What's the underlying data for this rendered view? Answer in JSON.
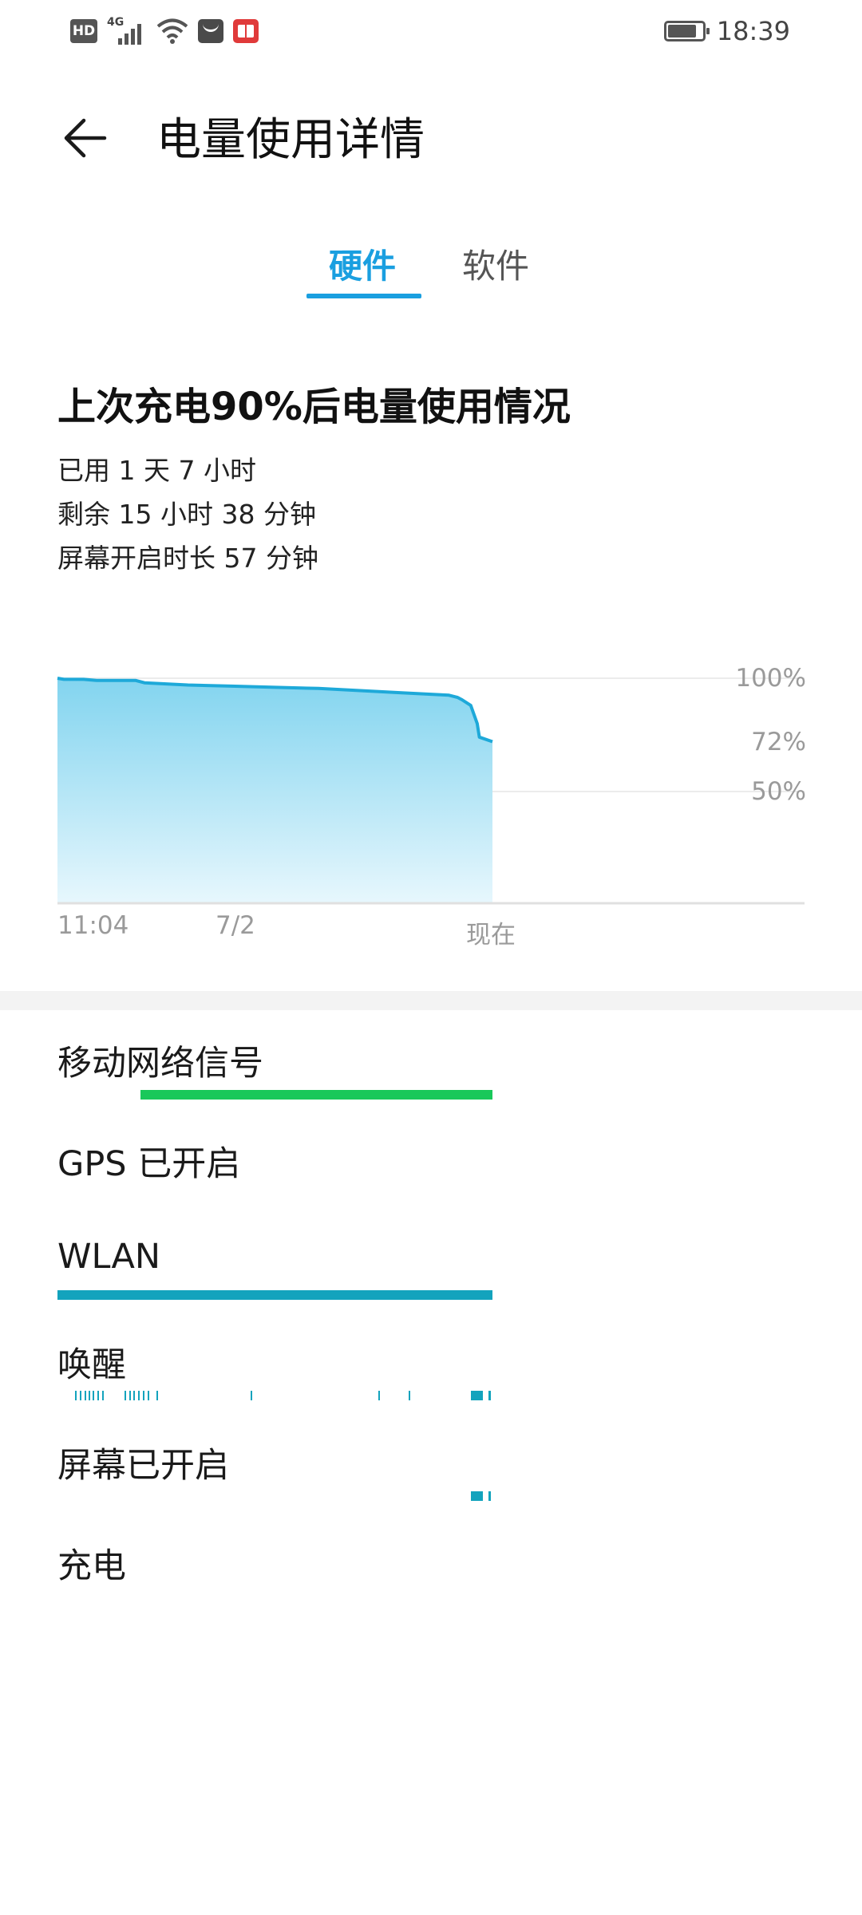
{
  "status_bar": {
    "hd_label": "HD",
    "network_label": "4G",
    "time": "18:39",
    "battery_level": 0.85,
    "icons": [
      "hd-icon",
      "signal-4g-icon",
      "wifi-icon",
      "huawei-app-icon",
      "book-app-icon",
      "battery-icon"
    ]
  },
  "header": {
    "title": "电量使用详情"
  },
  "tabs": [
    {
      "label": "硬件",
      "active": true
    },
    {
      "label": "软件",
      "active": false
    }
  ],
  "summary": {
    "title": "上次充电90%后电量使用情况",
    "used": "已用 1 天 7 小时",
    "remaining": "剩余 15 小时 38 分钟",
    "screen_on": "屏幕开启时长 57 分钟"
  },
  "chart_data": {
    "type": "area",
    "yticks": [
      "100%",
      "72%",
      "50%"
    ],
    "xticks": [
      "11:04",
      "7/2",
      "现在"
    ],
    "ylim": [
      0,
      100
    ],
    "x_fraction": [
      0,
      0.015,
      0.06,
      0.09,
      0.18,
      0.2,
      0.25,
      0.3,
      0.4,
      0.5,
      0.6,
      0.7,
      0.8,
      0.9,
      0.92,
      0.93,
      0.95,
      0.965,
      0.97,
      1.0
    ],
    "values": [
      100,
      99.5,
      99.5,
      99,
      99,
      98,
      97.5,
      97,
      96.5,
      96,
      95.5,
      94.5,
      93.5,
      92.5,
      91.5,
      90.5,
      88,
      80,
      74,
      72
    ],
    "grid": true,
    "colors": {
      "line": "#1ea9d9",
      "fill_top": "#82d4ef",
      "fill_bottom": "#e7f7fd"
    }
  },
  "hardware": {
    "items": [
      {
        "label": "移动网络信号",
        "bar_color": "#19c85a"
      },
      {
        "label": "GPS 已开启"
      },
      {
        "label": "WLAN",
        "bar_color": "#13a3bd"
      },
      {
        "label": "唤醒"
      },
      {
        "label": "屏幕已开启"
      },
      {
        "label": "充电"
      }
    ],
    "accent": "#13a3bd"
  }
}
